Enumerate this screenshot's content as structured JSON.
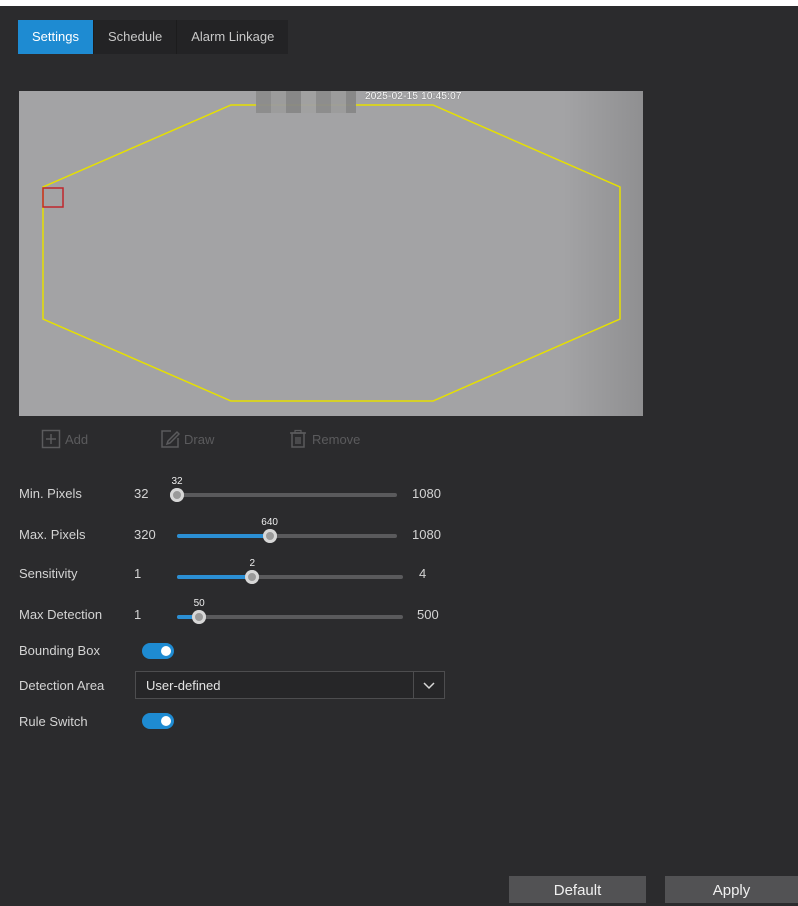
{
  "tabs": [
    {
      "label": "Settings",
      "active": true
    },
    {
      "label": "Schedule",
      "active": false
    },
    {
      "label": "Alarm Linkage",
      "active": false
    }
  ],
  "preview": {
    "timestamp": "2025-02-15 10:45:07",
    "region_color": "#e6e000",
    "min_box_color": "#c0262d"
  },
  "tools": {
    "add": "Add",
    "draw": "Draw",
    "remove": "Remove"
  },
  "min_pixels": {
    "label": "Min. Pixels",
    "min": "32",
    "max": "1080",
    "value": "32",
    "fraction": 0.0
  },
  "max_pixels": {
    "label": "Max. Pixels",
    "min": "320",
    "max": "1080",
    "value": "640",
    "fraction": 0.421
  },
  "sensitivity": {
    "label": "Sensitivity",
    "min": "1",
    "max": "4",
    "value": "2",
    "fraction": 0.333
  },
  "max_detection": {
    "label": "Max Detection",
    "min": "1",
    "max": "500",
    "value": "50",
    "fraction": 0.098
  },
  "bounding_box": {
    "label": "Bounding Box",
    "on": true
  },
  "detection_area": {
    "label": "Detection Area",
    "value": "User-defined"
  },
  "rule_switch": {
    "label": "Rule Switch",
    "on": true
  },
  "buttons": {
    "default": "Default",
    "apply": "Apply"
  },
  "colors": {
    "accent": "#1e8bd2",
    "background": "#2b2b2d"
  }
}
